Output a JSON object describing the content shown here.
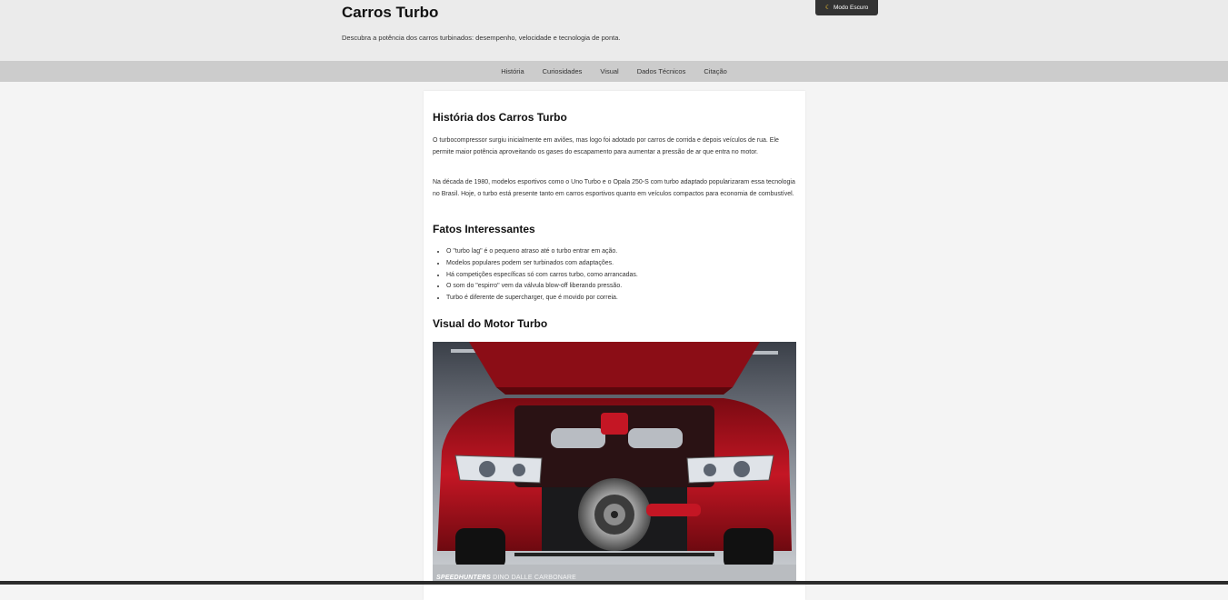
{
  "header": {
    "title": "Carros Turbo",
    "subtitle": "Descubra a potência dos carros turbinados: desempenho, velocidade e tecnologia de ponta.",
    "dark_mode_icon": "moon-icon",
    "dark_mode_label": "Modo Escuro"
  },
  "nav": {
    "items": [
      {
        "label": "História"
      },
      {
        "label": "Curiosidades"
      },
      {
        "label": "Visual"
      },
      {
        "label": "Dados Técnicos"
      },
      {
        "label": "Citação"
      }
    ]
  },
  "history": {
    "heading": "História dos Carros Turbo",
    "p1": "O turbocompressor surgiu inicialmente em aviões, mas logo foi adotado por carros de corrida e depois veículos de rua. Ele permite maior potência aproveitando os gases do escapamento para aumentar a pressão de ar que entra no motor.",
    "p2": "Na década de 1980, modelos esportivos como o Uno Turbo e o Opala 250-S com turbo adaptado popularizaram essa tecnologia no Brasil. Hoje, o turbo está presente tanto em carros esportivos quanto em veículos compactos para economia de combustível."
  },
  "facts": {
    "heading": "Fatos Interessantes",
    "items": [
      "O \"turbo lag\" é o pequeno atraso até o turbo entrar em ação.",
      "Modelos populares podem ser turbinados com adaptações.",
      "Há competições específicas só com carros turbo, como arrancadas.",
      "O som do \"espirro\" vem da válvula blow-off liberando pressão.",
      "Turbo é diferente de supercharger, que é movido por correia."
    ]
  },
  "visual": {
    "heading": "Visual do Motor Turbo",
    "watermark_brand": "SPEEDHUNTERS",
    "watermark_photographer": "DINO DALLE CARBONARE"
  },
  "colors": {
    "header_bg": "#ebebeb",
    "nav_bg": "#cccccc",
    "page_bg": "#f4f4f4",
    "car_red": "#b0101c"
  }
}
